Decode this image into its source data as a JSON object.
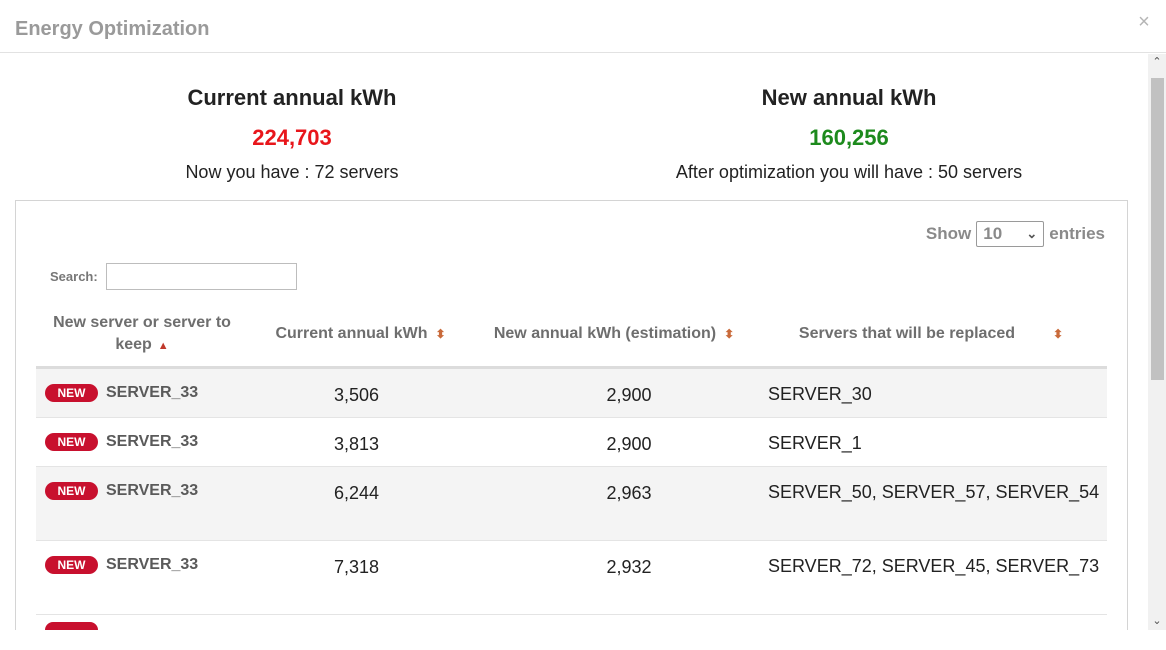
{
  "modal": {
    "title": "Energy Optimization",
    "close_label": "×"
  },
  "summary": {
    "current": {
      "title": "Current annual kWh",
      "value": "224,703",
      "note": "Now you have : 72 servers",
      "color": "#e8161b"
    },
    "new": {
      "title": "New annual kWh",
      "value": "160,256",
      "note": "After optimization you will have : 50 servers",
      "color": "#1d8a1d"
    }
  },
  "controls": {
    "show_label": "Show",
    "entries_value": "10",
    "entries_label": "entries",
    "search_label": "Search:",
    "search_value": ""
  },
  "table": {
    "columns": [
      "New server or server to keep",
      "Current annual kWh",
      "New annual kWh (estimation)",
      "Servers that will be replaced"
    ],
    "rows": [
      {
        "badge": "NEW",
        "server": "SERVER_33",
        "current": "3,506",
        "new": "2,900",
        "replaced": "SERVER_30"
      },
      {
        "badge": "NEW",
        "server": "SERVER_33",
        "current": "3,813",
        "new": "2,900",
        "replaced": "SERVER_1"
      },
      {
        "badge": "NEW",
        "server": "SERVER_33",
        "current": "6,244",
        "new": "2,963",
        "replaced": "SERVER_50, SERVER_57, SERVER_54"
      },
      {
        "badge": "NEW",
        "server": "SERVER_33",
        "current": "7,318",
        "new": "2,932",
        "replaced": "SERVER_72, SERVER_45, SERVER_73"
      }
    ]
  },
  "icons": {
    "close": "close-icon",
    "sort": "sort-both-icon",
    "sort_asc": "sort-asc-icon",
    "chevron": "chevron-down-icon"
  }
}
